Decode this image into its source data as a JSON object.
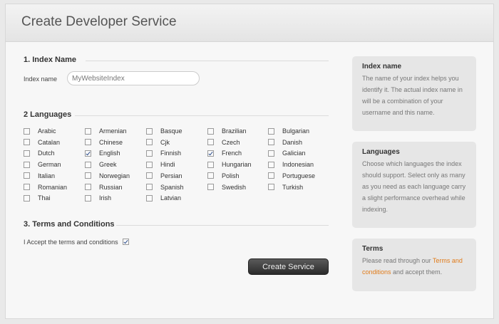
{
  "header": {
    "title": "Create Developer Service"
  },
  "index_section": {
    "title": "1. Index Name",
    "label": "Index name",
    "value": "MyWebsiteIndex"
  },
  "languages_section": {
    "title": "2 Languages",
    "items": [
      {
        "label": "Arabic",
        "checked": false
      },
      {
        "label": "Armenian",
        "checked": false
      },
      {
        "label": "Basque",
        "checked": false
      },
      {
        "label": "Brazilian",
        "checked": false
      },
      {
        "label": "Bulgarian",
        "checked": false
      },
      {
        "label": "Catalan",
        "checked": false
      },
      {
        "label": "Chinese",
        "checked": false
      },
      {
        "label": "Cjk",
        "checked": false
      },
      {
        "label": "Czech",
        "checked": false
      },
      {
        "label": "Danish",
        "checked": false
      },
      {
        "label": "Dutch",
        "checked": false
      },
      {
        "label": "English",
        "checked": true
      },
      {
        "label": "Finnish",
        "checked": false
      },
      {
        "label": "French",
        "checked": true
      },
      {
        "label": "Galician",
        "checked": false
      },
      {
        "label": "German",
        "checked": false
      },
      {
        "label": "Greek",
        "checked": false
      },
      {
        "label": "Hindi",
        "checked": false
      },
      {
        "label": "Hungarian",
        "checked": false
      },
      {
        "label": "Indonesian",
        "checked": false
      },
      {
        "label": "Italian",
        "checked": false
      },
      {
        "label": "Norwegian",
        "checked": false
      },
      {
        "label": "Persian",
        "checked": false
      },
      {
        "label": "Polish",
        "checked": false
      },
      {
        "label": "Portuguese",
        "checked": false
      },
      {
        "label": "Romanian",
        "checked": false
      },
      {
        "label": "Russian",
        "checked": false
      },
      {
        "label": "Spanish",
        "checked": false
      },
      {
        "label": "Swedish",
        "checked": false
      },
      {
        "label": "Turkish",
        "checked": false
      },
      {
        "label": "Thai",
        "checked": false
      },
      {
        "label": "Irish",
        "checked": false
      },
      {
        "label": "Latvian",
        "checked": false
      }
    ]
  },
  "terms_section": {
    "title": "3. Terms and Conditions",
    "accept_label": "I Accept the terms and conditions",
    "accept_checked": true
  },
  "submit": {
    "label": "Create Service"
  },
  "sidebar": {
    "index_name": {
      "title": "Index name",
      "body": "The name of your index helps you identify it. The actual index name in will be a combination of your username and this name."
    },
    "languages": {
      "title": "Languages",
      "body": "Choose which languages the index should support. Select only as many as you need as each language carry a slight performance overhead while indexing."
    },
    "terms": {
      "title": "Terms",
      "body_before": "Please read through our ",
      "link": "Terms and conditions",
      "body_after": " and accept them."
    }
  }
}
